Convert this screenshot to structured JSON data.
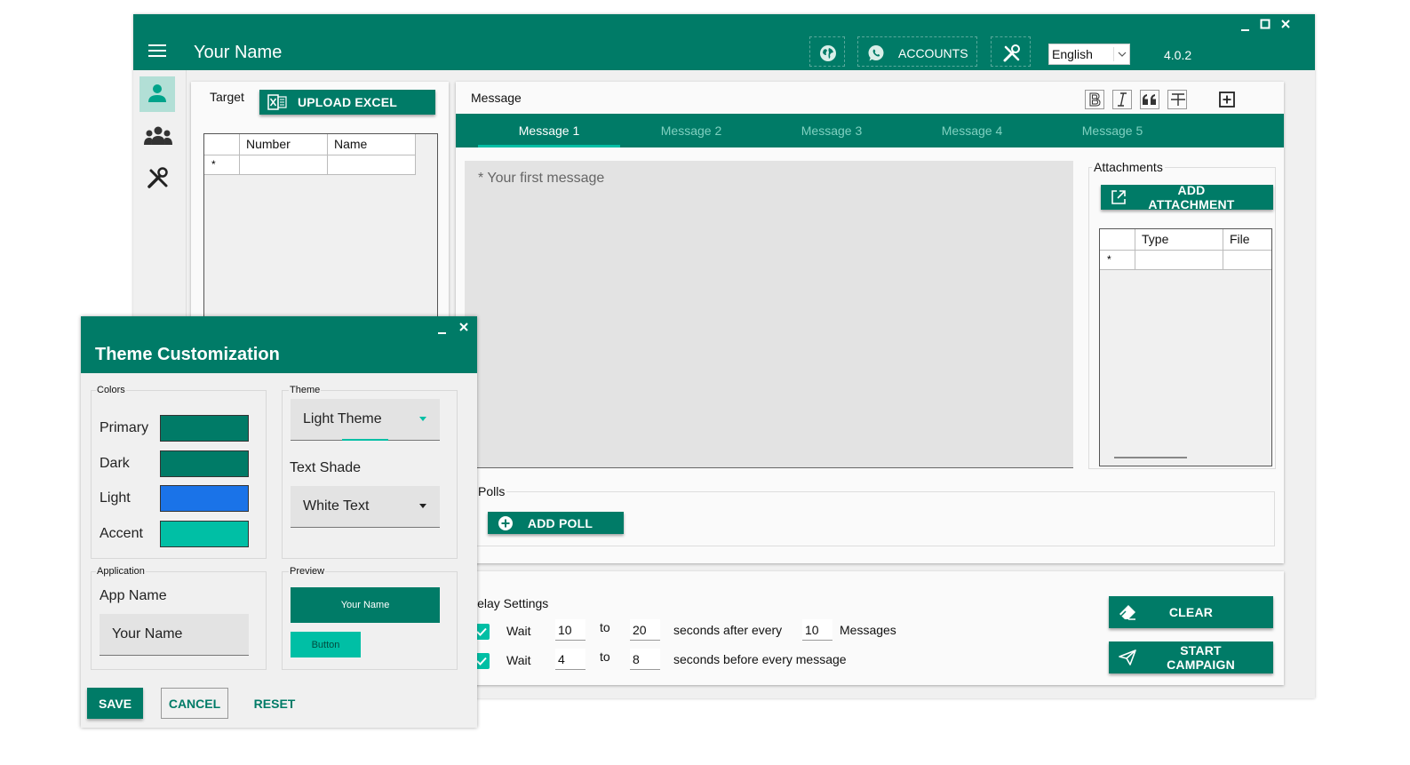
{
  "app": {
    "title": "Your Name",
    "version": "4.0.2",
    "accounts_label": "ACCOUNTS",
    "language": "English",
    "icons": [
      "menu-icon",
      "globe-icon",
      "whatsapp-icon",
      "tools-icon",
      "minimize-icon",
      "maximize-icon",
      "close-icon"
    ]
  },
  "sidebar": {
    "items": [
      {
        "name": "contact",
        "icon": "person-icon",
        "active": true
      },
      {
        "name": "groups",
        "icon": "group-icon"
      },
      {
        "name": "tools",
        "icon": "tools-icon"
      }
    ]
  },
  "target": {
    "label": "Target",
    "upload_label": "UPLOAD EXCEL",
    "columns": [
      "Number",
      "Name"
    ],
    "row_marker": "*"
  },
  "message": {
    "label": "Message",
    "format_buttons": [
      "bold-icon",
      "italic-icon",
      "quote-icon",
      "strikethrough-icon",
      "add-box-icon"
    ],
    "tabs": [
      "Message 1",
      "Message 2",
      "Message 3",
      "Message 4",
      "Message 5"
    ],
    "placeholder": "* Your first message"
  },
  "attachments": {
    "label": "Attachments",
    "add_label": "ADD ATTACHMENT",
    "columns": [
      "Type",
      "File"
    ],
    "row_marker": "*"
  },
  "polls": {
    "label": "Polls",
    "add_label": "ADD POLL"
  },
  "delay": {
    "label": "Delay Settings",
    "rows": [
      {
        "wait": "Wait",
        "from": "10",
        "to_label": "to",
        "to": "20",
        "after": "seconds after every",
        "count": "10",
        "suffix": "Messages"
      },
      {
        "wait": "Wait",
        "from": "4",
        "to_label": "to",
        "to": "8",
        "after": "seconds before every message"
      }
    ]
  },
  "actions": {
    "clear_label": "CLEAR",
    "start_label": "START CAMPAIGN"
  },
  "theme_dialog": {
    "title": "Theme Customization",
    "colors_group": "Colors",
    "colors": [
      {
        "label": "Primary",
        "hex": "#007b67"
      },
      {
        "label": "Dark",
        "hex": "#007b67"
      },
      {
        "label": "Light",
        "hex": "#1a73e8"
      },
      {
        "label": "Accent",
        "hex": "#00bfa5"
      }
    ],
    "theme_group": "Theme",
    "theme_value": "Light Theme",
    "text_shade_label": "Text Shade",
    "text_shade_value": "White Text",
    "application_group": "Application",
    "app_name_label": "App Name",
    "app_name_value": "Your Name",
    "preview_group": "Preview",
    "preview_title": "Your Name",
    "preview_button": "Button",
    "save_label": "SAVE",
    "cancel_label": "CANCEL",
    "reset_label": "RESET"
  }
}
